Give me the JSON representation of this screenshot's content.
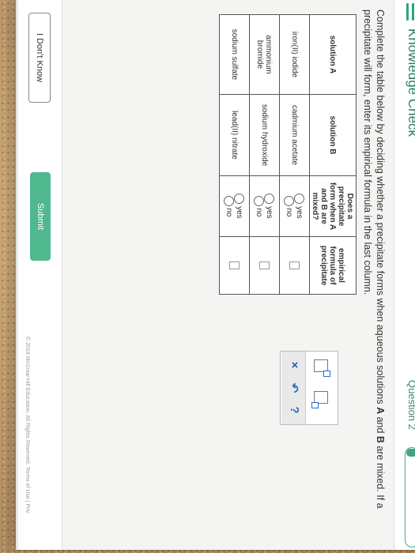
{
  "app": {
    "title": "Knowledge Check",
    "question_label": "Question 2",
    "progress": 0.05,
    "accent_color": "#2aa57a"
  },
  "prompt": {
    "part1": "Complete the table below by deciding whether a precipitate forms when aqueous solutions ",
    "a": "A",
    "and": " and ",
    "b": "B",
    "part2": " are mixed. If a precipitate will form, enter its empirical formula in the last column."
  },
  "table": {
    "headers": [
      "solution A",
      "solution B",
      "Does a precipitate form when A and B are mixed?",
      "empirical formula of precipitate"
    ],
    "rows": [
      {
        "a": "iron(II) iodide",
        "b": "cadmium acetate"
      },
      {
        "a": "ammonium bromide",
        "b": "sodium hydroxide"
      },
      {
        "a": "sodium sulfate",
        "b": "lead(II) nitrate"
      }
    ],
    "yes_label": "yes",
    "no_label": "no"
  },
  "palette": {
    "clear": "×",
    "undo": "↶",
    "help": "?"
  },
  "footer": {
    "dont_know": "I Don't Know",
    "submit": "Submit",
    "copyright": "© 2019 McGraw-Hill Education. All Rights Reserved. Terms of Use | Priv"
  }
}
